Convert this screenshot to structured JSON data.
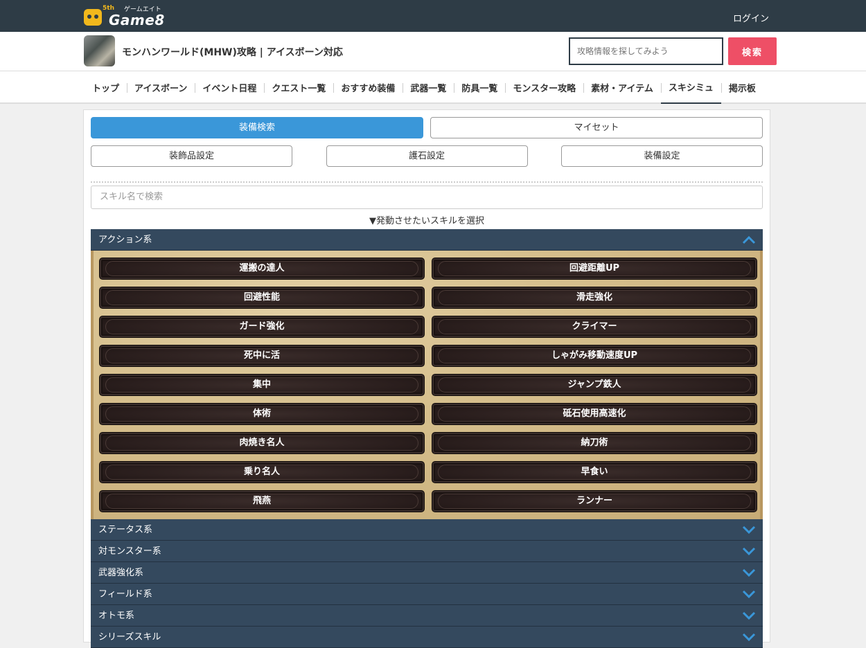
{
  "topbar": {
    "logo_kana": "ゲームエイト",
    "logo_main": "Game8",
    "logo_badge": "5th",
    "login": "ログイン"
  },
  "header": {
    "title": "モンハンワールド(MHW)攻略 | アイスボーン対応",
    "search_placeholder": "攻略情報を探してみよう",
    "search_button": "検索"
  },
  "nav": [
    "トップ",
    "アイスボーン",
    "イベント日程",
    "クエスト一覧",
    "おすすめ装備",
    "武器一覧",
    "防具一覧",
    "モンスター攻略",
    "素材・アイテム",
    "スキシミュ",
    "掲示板"
  ],
  "tabs": {
    "search": "装備検索",
    "myset": "マイセット"
  },
  "settings": {
    "deco": "装飾品設定",
    "charm": "護石設定",
    "equip": "装備設定"
  },
  "skill_search_placeholder": "スキル名で検索",
  "select_label": "▼発動させたいスキルを選択",
  "categories": [
    "アクション系",
    "ステータス系",
    "対モンスター系",
    "武器強化系",
    "フィールド系",
    "オトモ系",
    "シリーズスキル"
  ],
  "skills": [
    "運搬の達人",
    "回避距離UP",
    "回避性能",
    "滑走強化",
    "ガード強化",
    "クライマー",
    "死中に活",
    "しゃがみ移動速度UP",
    "集中",
    "ジャンプ鉄人",
    "体術",
    "砥石使用高速化",
    "肉焼き名人",
    "納刀術",
    "乗り名人",
    "早食い",
    "飛燕",
    "ランナー"
  ],
  "colors": {
    "topbar": "#2e3c46",
    "accent_blue": "#3a97d9",
    "search_red": "#ee4f66",
    "category_bar": "#34495e",
    "chevron": "#3a97d9"
  }
}
